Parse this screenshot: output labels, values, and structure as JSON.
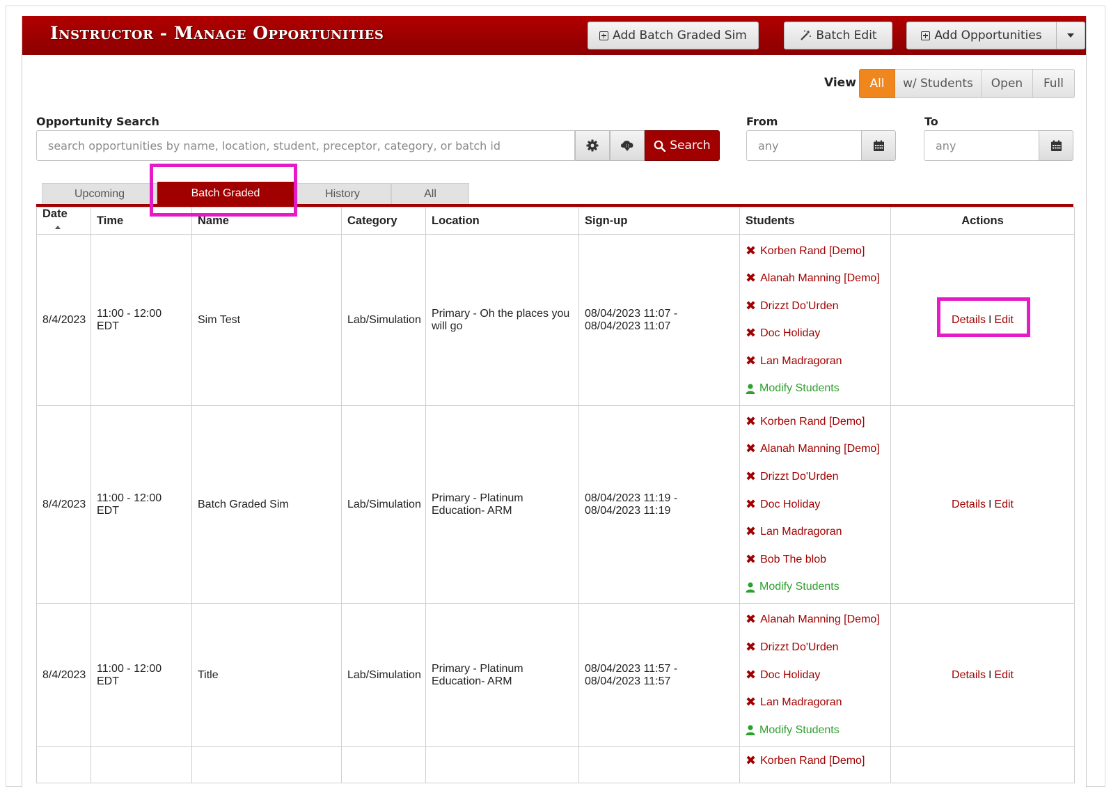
{
  "header": {
    "title": "Instructor - Manage Opportunities",
    "add_batch_graded_sim": "Add Batch Graded Sim",
    "batch_edit": "Batch Edit",
    "add_opportunities": "Add Opportunities"
  },
  "view": {
    "label": "View",
    "options": [
      "All",
      "w/ Students",
      "Open",
      "Full"
    ],
    "selected": "All"
  },
  "search": {
    "label": "Opportunity Search",
    "placeholder": "search opportunities by name, location, student, preceptor, category, or batch id",
    "button": "Search"
  },
  "dates": {
    "from_label": "From",
    "from_placeholder": "any",
    "to_label": "To",
    "to_placeholder": "any"
  },
  "tabs": [
    "Upcoming",
    "Batch Graded",
    "History",
    "All"
  ],
  "active_tab": "Batch Graded",
  "table": {
    "headers": [
      "Date",
      "Time",
      "Name",
      "Category",
      "Location",
      "Sign-up",
      "Students",
      "Actions"
    ],
    "details_label": "Details",
    "edit_label": "Edit",
    "separator": "I",
    "modify_label": "Modify Students",
    "rows": [
      {
        "date": "8/4/2023",
        "time": "11:00 - 12:00 EDT",
        "name": "Sim Test",
        "category": "Lab/Simulation",
        "location": "Primary - Oh the places you will go",
        "signup_start": "08/04/2023 11:07 -",
        "signup_end": "08/04/2023 11:07",
        "students": [
          "Korben Rand [Demo]",
          "Alanah Manning [Demo]",
          "Drizzt Do'Urden",
          "Doc Holiday",
          "Lan Madragoran"
        ]
      },
      {
        "date": "8/4/2023",
        "time": "11:00 - 12:00 EDT",
        "name": "Batch Graded Sim",
        "category": "Lab/Simulation",
        "location": "Primary - Platinum Education- ARM",
        "signup_start": "08/04/2023 11:19 -",
        "signup_end": "08/04/2023 11:19",
        "students": [
          "Korben Rand [Demo]",
          "Alanah Manning [Demo]",
          "Drizzt Do'Urden",
          "Doc Holiday",
          "Lan Madragoran",
          "Bob The blob"
        ]
      },
      {
        "date": "8/4/2023",
        "time": "11:00 - 12:00 EDT",
        "name": "Title",
        "category": "Lab/Simulation",
        "location": "Primary - Platinum Education- ARM",
        "signup_start": "08/04/2023 11:57 -",
        "signup_end": "08/04/2023 11:57",
        "students": [
          "Alanah Manning [Demo]",
          "Drizzt Do'Urden",
          "Doc Holiday",
          "Lan Madragoran"
        ]
      },
      {
        "date": "",
        "time": "",
        "name": "",
        "category": "",
        "location": "",
        "signup_start": "",
        "signup_end": "",
        "students": [
          "Korben Rand [Demo]"
        ]
      }
    ]
  },
  "colors": {
    "brand_red": "#a10000",
    "active_orange": "#f0861e",
    "highlight_magenta": "#e51bc8",
    "modify_green": "#2ea02e"
  }
}
